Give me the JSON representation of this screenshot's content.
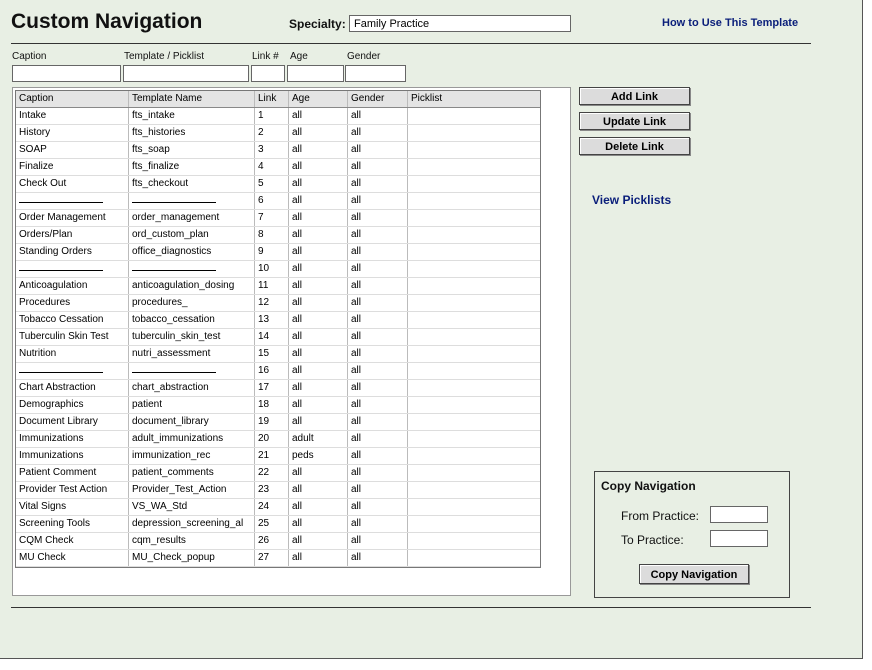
{
  "title": "Custom Navigation",
  "specialty": {
    "label": "Specialty:",
    "value": "Family Practice"
  },
  "howto_link": "How to Use This Template",
  "fields": {
    "caption": "Caption",
    "template": "Template / Picklist",
    "link": "Link #",
    "age": "Age",
    "gender": "Gender"
  },
  "table": {
    "headers": [
      "Caption",
      "Template Name",
      "Link",
      "Age",
      "Gender",
      "Picklist"
    ],
    "rows": [
      [
        "Intake",
        "fts_intake",
        "1",
        "all",
        "all",
        ""
      ],
      [
        "History",
        "fts_histories",
        "2",
        "all",
        "all",
        ""
      ],
      [
        "SOAP",
        "fts_soap",
        "3",
        "all",
        "all",
        ""
      ],
      [
        "Finalize",
        "fts_finalize",
        "4",
        "all",
        "all",
        ""
      ],
      [
        "Check Out",
        "fts_checkout",
        "5",
        "all",
        "all",
        ""
      ],
      [
        "---",
        "---",
        "6",
        "all",
        "all",
        ""
      ],
      [
        "Order Management",
        "order_management",
        "7",
        "all",
        "all",
        ""
      ],
      [
        "Orders/Plan",
        "ord_custom_plan",
        "8",
        "all",
        "all",
        ""
      ],
      [
        "Standing Orders",
        "office_diagnostics",
        "9",
        "all",
        "all",
        ""
      ],
      [
        "---",
        "---",
        "10",
        "all",
        "all",
        ""
      ],
      [
        "Anticoagulation",
        "anticoagulation_dosing",
        "11",
        "all",
        "all",
        ""
      ],
      [
        "Procedures",
        "procedures_",
        "12",
        "all",
        "all",
        ""
      ],
      [
        "Tobacco Cessation",
        "tobacco_cessation",
        "13",
        "all",
        "all",
        ""
      ],
      [
        "Tuberculin Skin Test",
        "tuberculin_skin_test",
        "14",
        "all",
        "all",
        ""
      ],
      [
        "Nutrition",
        "nutri_assessment",
        "15",
        "all",
        "all",
        ""
      ],
      [
        "---",
        "---",
        "16",
        "all",
        "all",
        ""
      ],
      [
        "Chart Abstraction",
        "chart_abstraction",
        "17",
        "all",
        "all",
        ""
      ],
      [
        "Demographics",
        "patient",
        "18",
        "all",
        "all",
        ""
      ],
      [
        "Document Library",
        "document_library",
        "19",
        "all",
        "all",
        ""
      ],
      [
        "Immunizations",
        "adult_immunizations",
        "20",
        "adult",
        "all",
        ""
      ],
      [
        "Immunizations",
        "immunization_rec",
        "21",
        "peds",
        "all",
        ""
      ],
      [
        "Patient Comment",
        "patient_comments",
        "22",
        "all",
        "all",
        ""
      ],
      [
        "Provider Test Action",
        "Provider_Test_Action",
        "23",
        "all",
        "all",
        ""
      ],
      [
        "Vital Signs",
        "VS_WA_Std",
        "24",
        "all",
        "all",
        ""
      ],
      [
        "Screening Tools",
        "depression_screening_al",
        "25",
        "all",
        "all",
        ""
      ],
      [
        "CQM Check",
        "cqm_results",
        "26",
        "all",
        "all",
        ""
      ],
      [
        "MU Check",
        "MU_Check_popup",
        "27",
        "all",
        "all",
        ""
      ]
    ]
  },
  "buttons": {
    "add": "Add Link",
    "update": "Update Link",
    "delete": "Delete Link"
  },
  "view_picklists": "View Picklists",
  "copy": {
    "title": "Copy Navigation",
    "from": "From Practice:",
    "to": "To Practice:",
    "button": "Copy Navigation"
  }
}
